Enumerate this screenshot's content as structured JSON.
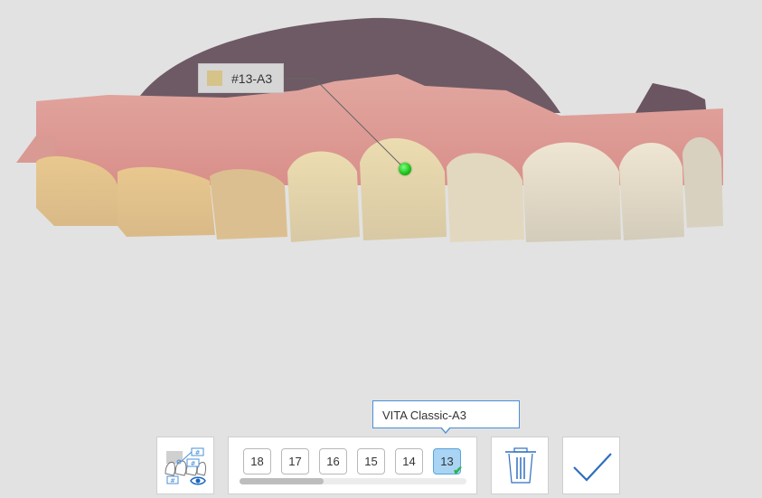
{
  "annotation": {
    "label": "#13-A3",
    "swatch_color": "#d6c38a",
    "marker_color": "#22c022"
  },
  "tooltip": {
    "text": "VITA Classic-A3"
  },
  "tooth_selector": {
    "teeth": [
      "18",
      "17",
      "16",
      "15",
      "14",
      "13"
    ],
    "selected": "13",
    "scroll_fraction": 0.37
  },
  "toolbar": {
    "toggle_icon": "tooth-number-visibility-icon",
    "trash_icon": "trash-icon",
    "confirm_icon": "checkmark-icon"
  },
  "colors": {
    "accent": "#4a90d9",
    "selected_tooth": "#a9d4f4",
    "check_green": "#2bb34a"
  }
}
